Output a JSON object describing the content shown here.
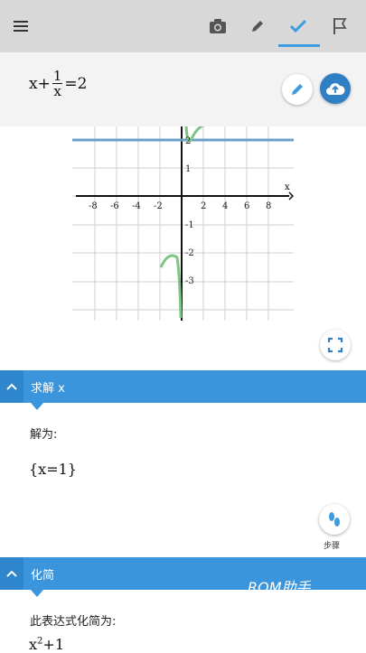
{
  "toolbar": {
    "menu_icon": "hamburger-icon",
    "camera_icon": "camera-icon",
    "pencil_icon": "pencil-icon",
    "check_icon": "check-icon",
    "flag_icon": "flag-icon",
    "accent_color": "#3d9be0"
  },
  "equation": {
    "lhs_var": "x+",
    "frac_num": "1",
    "frac_den": "x",
    "rhs": "=2",
    "edit_icon": "pencil-icon",
    "cloud_icon": "cloud-upload-icon"
  },
  "graph": {
    "x_axis_label": "x",
    "x_ticks": [
      "-8",
      "-6",
      "-4",
      "-2",
      "2",
      "4",
      "6",
      "8"
    ],
    "y_ticks": [
      "2",
      "1",
      "-1",
      "-2",
      "-3"
    ],
    "expand_icon": "fullscreen-icon"
  },
  "solve": {
    "header": "求解 x",
    "label": "解为:",
    "solution": "{x=1}",
    "steps_label": "步骤",
    "steps_icon": "footprints-icon"
  },
  "simplify": {
    "header": "化简",
    "label": "此表达式化简为:",
    "expr_base": "x",
    "expr_exp": "2",
    "expr_rest": "+1"
  },
  "watermark": "ROM助手"
}
